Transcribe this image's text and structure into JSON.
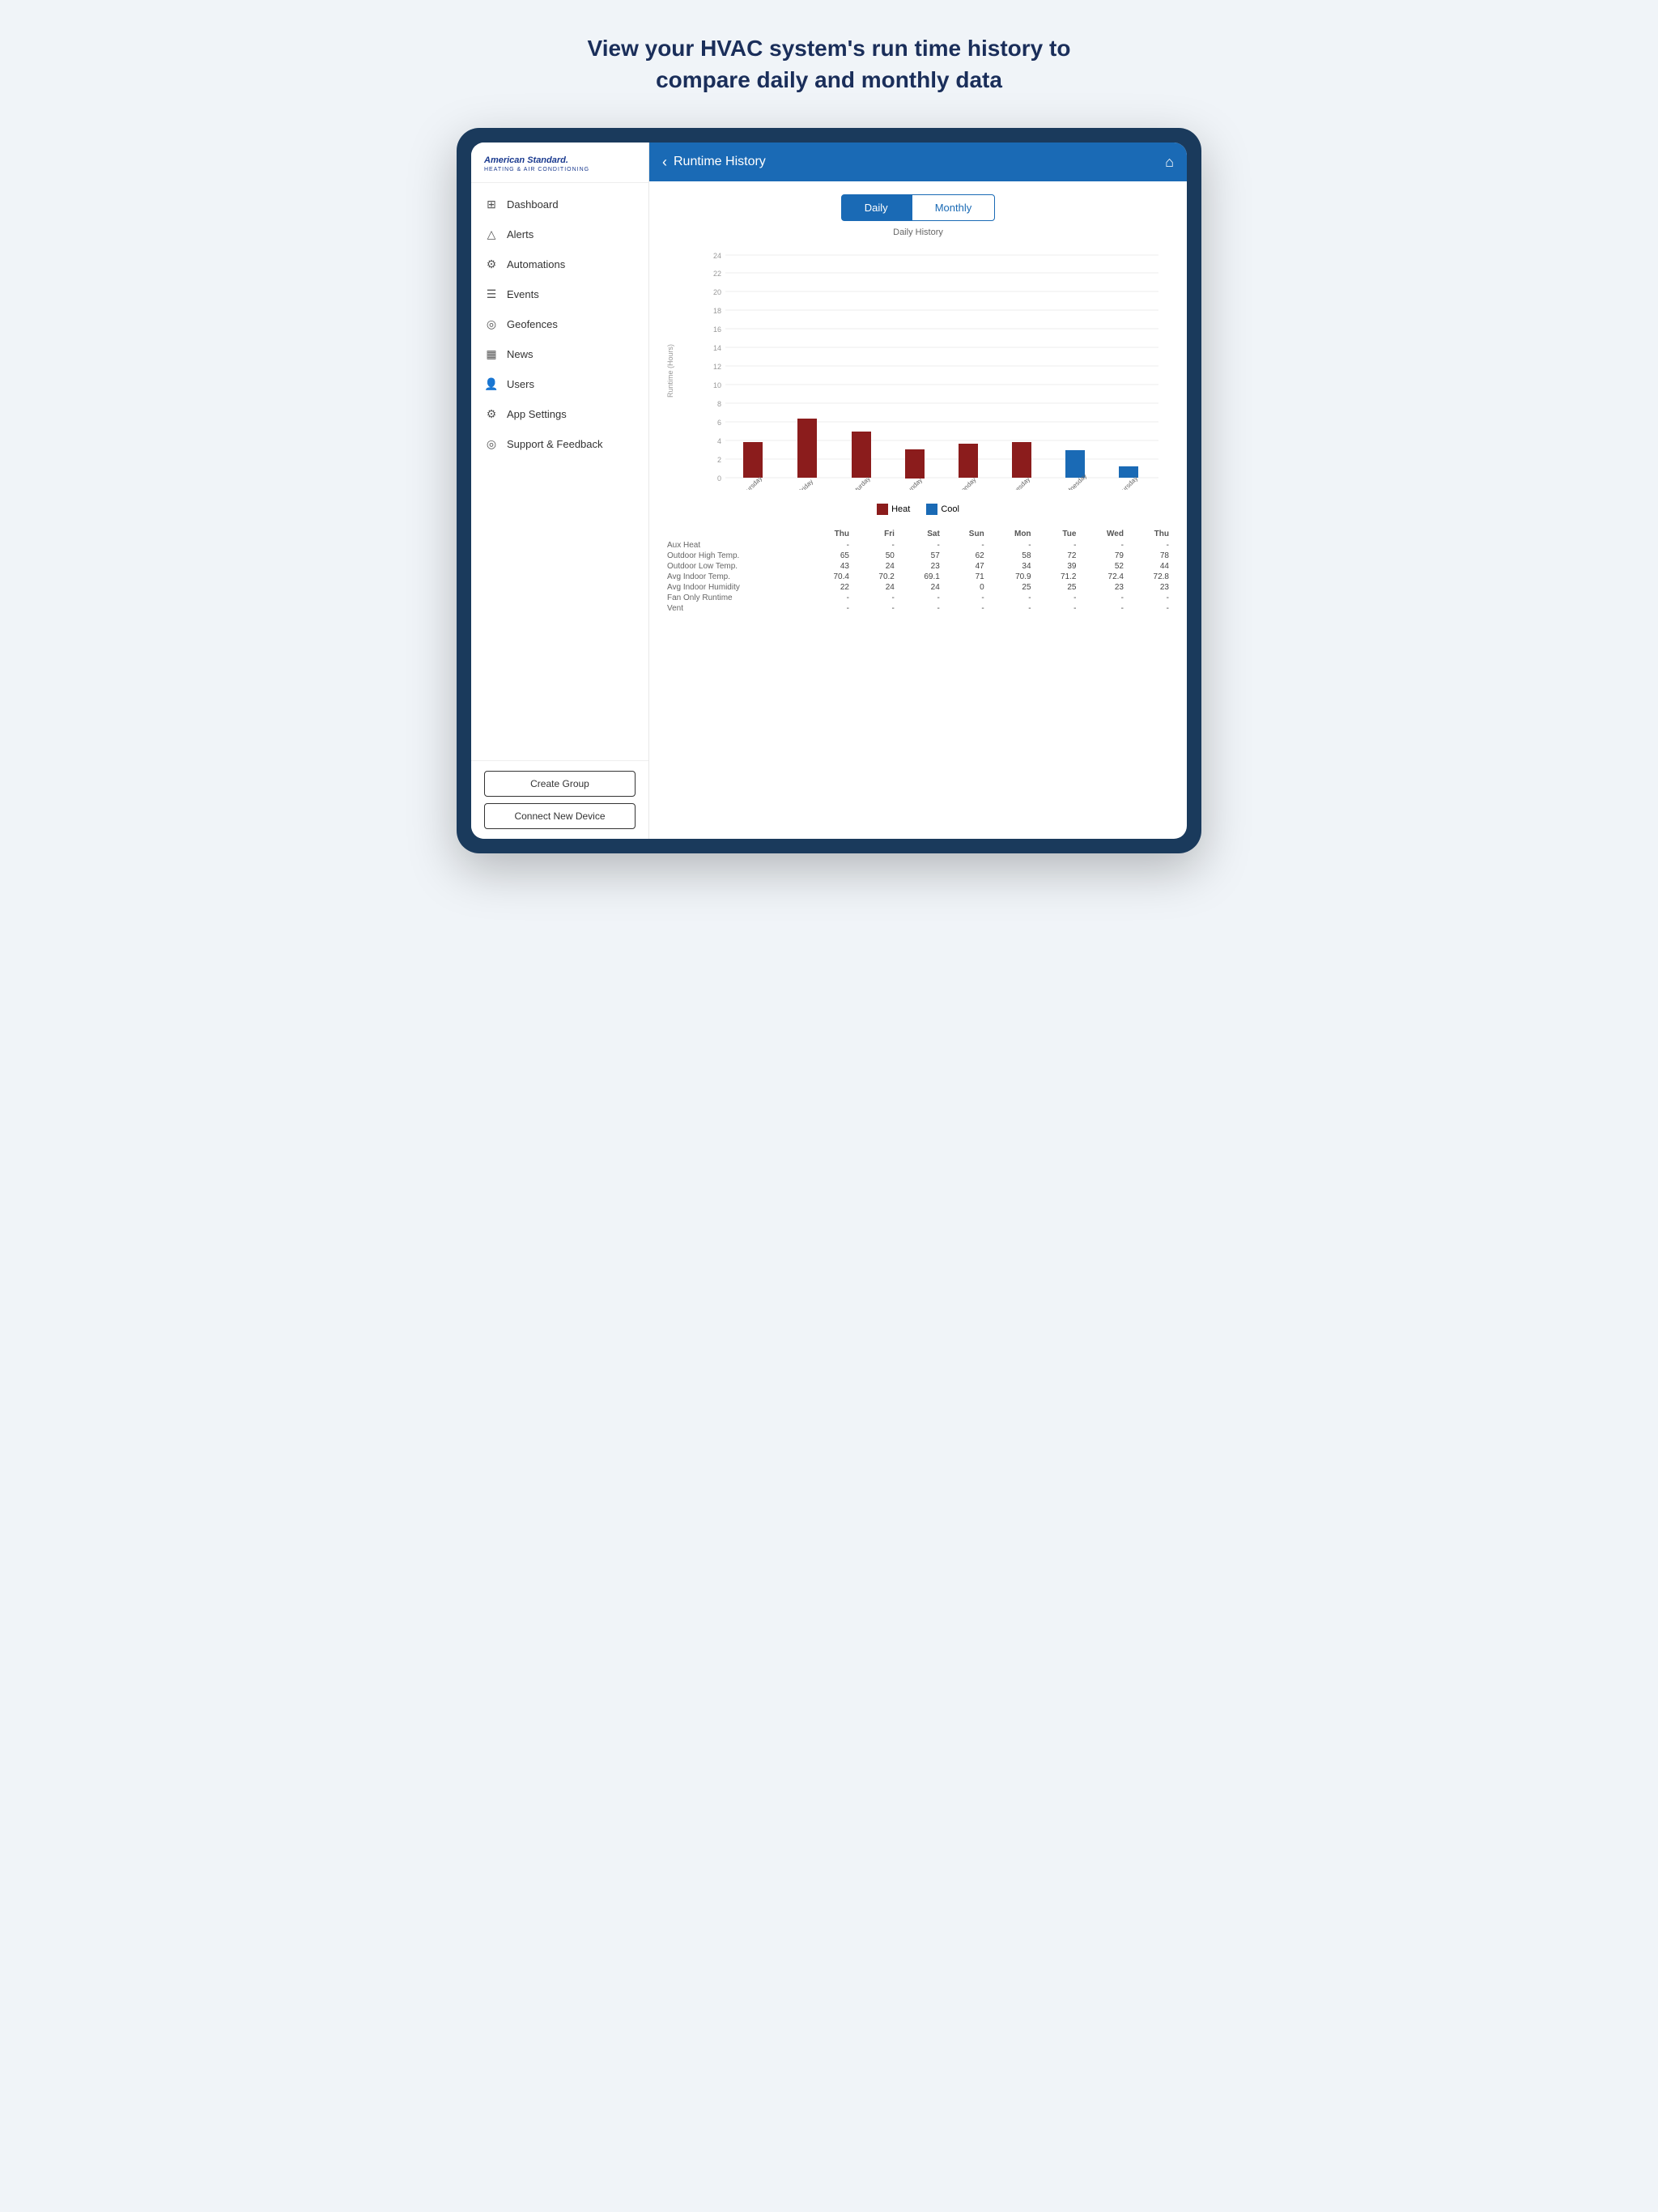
{
  "page": {
    "headline_line1": "View your HVAC system's run time history to",
    "headline_line2": "compare daily and monthly data"
  },
  "sidebar": {
    "logo_main": "American Standard.",
    "logo_sub": "HEATING & AIR CONDITIONING",
    "nav_items": [
      {
        "id": "dashboard",
        "label": "Dashboard",
        "icon": "⊞"
      },
      {
        "id": "alerts",
        "label": "Alerts",
        "icon": "△"
      },
      {
        "id": "automations",
        "label": "Automations",
        "icon": "⚙"
      },
      {
        "id": "events",
        "label": "Events",
        "icon": "☰"
      },
      {
        "id": "geofences",
        "label": "Geofences",
        "icon": "◎"
      },
      {
        "id": "news",
        "label": "News",
        "icon": "▦"
      },
      {
        "id": "users",
        "label": "Users",
        "icon": "👤"
      },
      {
        "id": "app-settings",
        "label": "App Settings",
        "icon": "⚙"
      },
      {
        "id": "support",
        "label": "Support & Feedback",
        "icon": "◎"
      }
    ],
    "btn_create_group": "Create Group",
    "btn_connect_device": "Connect New Device"
  },
  "topbar": {
    "title": "Runtime History",
    "back_label": "‹",
    "home_label": "⌂"
  },
  "tabs": {
    "daily_label": "Daily",
    "monthly_label": "Monthly",
    "active": "daily"
  },
  "chart": {
    "title": "Daily History",
    "y_axis_label": "Runtime (Hours)",
    "y_ticks": [
      0,
      2,
      4,
      6,
      8,
      10,
      12,
      14,
      16,
      18,
      20,
      22,
      24
    ],
    "bars": [
      {
        "day": "Thursday",
        "heat": 3.8,
        "cool": 0
      },
      {
        "day": "Friday",
        "heat": 6.4,
        "cool": 0
      },
      {
        "day": "Saturday",
        "heat": 5.0,
        "cool": 0
      },
      {
        "day": "Sunday",
        "heat": 3.1,
        "cool": 0
      },
      {
        "day": "Monday",
        "heat": 3.7,
        "cool": 0
      },
      {
        "day": "Tuesday",
        "heat": 3.8,
        "cool": 0
      },
      {
        "day": "Wednesday",
        "heat": 0,
        "cool": 3.0
      },
      {
        "day": "Thursday",
        "heat": 0,
        "cool": 1.2
      }
    ],
    "legend_heat": "Heat",
    "legend_cool": "Cool",
    "heat_color": "#8b1c1c",
    "cool_color": "#1a6ab5"
  },
  "table": {
    "headers": [
      "",
      "Thu",
      "Fri",
      "Sat",
      "Sun",
      "Mon",
      "Tue",
      "Wed",
      "Thu"
    ],
    "rows": [
      {
        "label": "Aux Heat",
        "values": [
          "-",
          "-",
          "-",
          "-",
          "-",
          "-",
          "-",
          "-"
        ]
      },
      {
        "label": "Outdoor High Temp.",
        "values": [
          "65",
          "50",
          "57",
          "62",
          "58",
          "72",
          "79",
          "78"
        ]
      },
      {
        "label": "Outdoor Low Temp.",
        "values": [
          "43",
          "24",
          "23",
          "47",
          "34",
          "39",
          "52",
          "44"
        ]
      },
      {
        "label": "Avg Indoor Temp.",
        "values": [
          "70.4",
          "70.2",
          "69.1",
          "71",
          "70.9",
          "71.2",
          "72.4",
          "72.8"
        ]
      },
      {
        "label": "Avg Indoor Humidity",
        "values": [
          "22",
          "24",
          "24",
          "0",
          "25",
          "25",
          "23",
          "23"
        ]
      },
      {
        "label": "Fan Only Runtime",
        "values": [
          "-",
          "-",
          "-",
          "-",
          "-",
          "-",
          "-",
          "-"
        ]
      },
      {
        "label": "Vent",
        "values": [
          "-",
          "-",
          "-",
          "-",
          "-",
          "-",
          "-",
          "-"
        ]
      }
    ]
  }
}
